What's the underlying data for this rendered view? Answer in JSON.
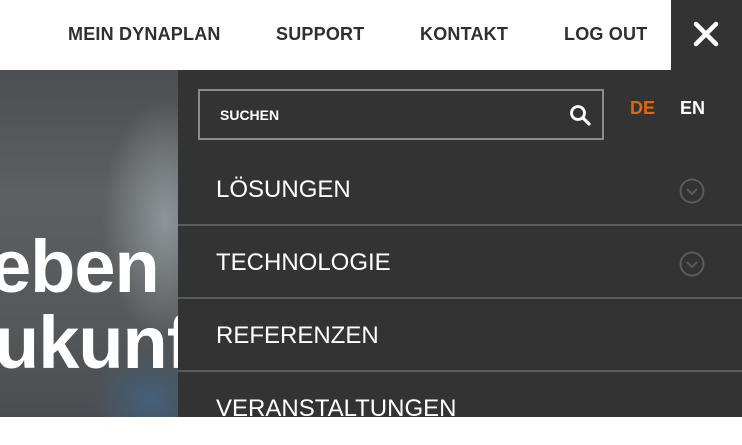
{
  "topnav": {
    "items": [
      "MEIN DYNAPLAN",
      "SUPPORT",
      "KONTAKT",
      "LOG OUT"
    ],
    "close_icon": "close-icon"
  },
  "hero": {
    "line1": "eben",
    "line2": "ukunf"
  },
  "search": {
    "placeholder": "SUCHEN",
    "value": "",
    "icon": "search-icon"
  },
  "languages": {
    "items": [
      "DE",
      "EN"
    ],
    "active": "DE",
    "active_color": "#e8630a"
  },
  "menu": {
    "items": [
      {
        "label": "LÖSUNGEN",
        "expandable": true
      },
      {
        "label": "TECHNOLOGIE",
        "expandable": true
      },
      {
        "label": "REFERENZEN",
        "expandable": false
      },
      {
        "label": "VERANSTALTUNGEN",
        "expandable": false
      }
    ]
  },
  "colors": {
    "panel": "#333333",
    "topbar": "#ffffff",
    "accent": "#e8630a"
  }
}
